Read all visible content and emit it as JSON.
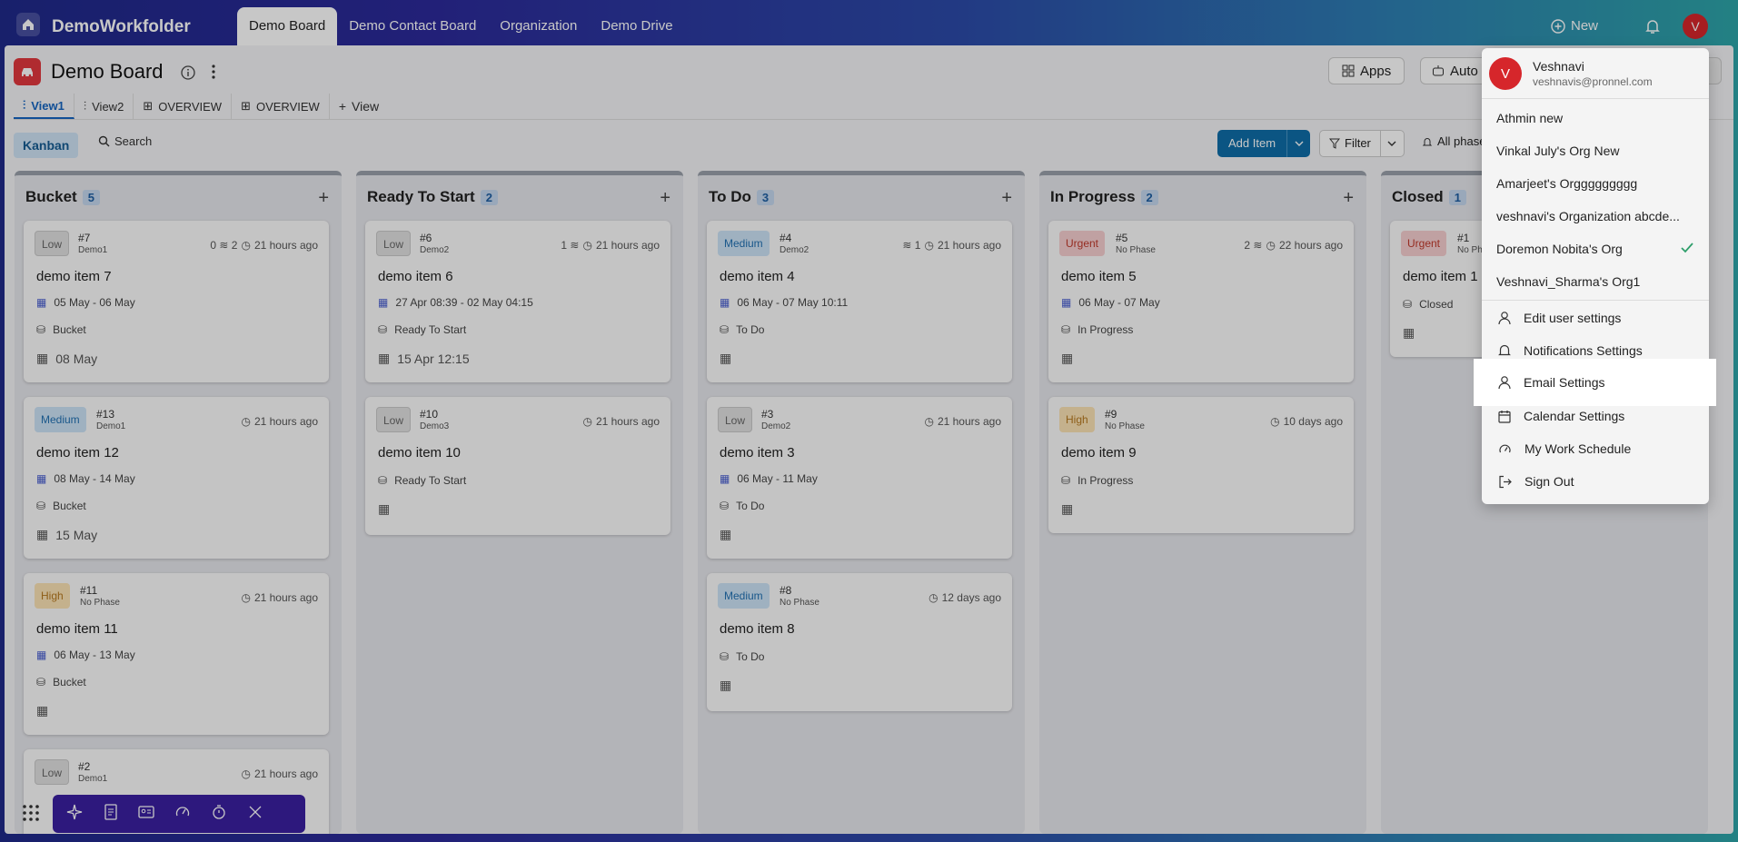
{
  "app": {
    "name": "DemoWorkfolder"
  },
  "top_tabs": [
    "Demo Board",
    "Demo Contact Board",
    "Organization",
    "Demo Drive"
  ],
  "header": {
    "new_label": "New",
    "avatar_letter": "V"
  },
  "board": {
    "title": "Demo Board",
    "apps_label": "Apps",
    "auto_label": "Auto",
    "view_tabs": [
      "View1",
      "View2",
      "OVERVIEW",
      "OVERVIEW"
    ],
    "add_view_label": "View",
    "kanban_label": "Kanban",
    "search_label": "Search",
    "add_item_label": "Add Item",
    "filter_label": "Filter",
    "phases_label": "All phases"
  },
  "columns": [
    {
      "name": "Bucket",
      "count": "5",
      "cards": [
        {
          "priority": "Low",
          "num": "#7",
          "sub": "Demo1",
          "meta": "0 ≋ 2",
          "time": "21 hours ago",
          "title": "demo item 7",
          "dates": "05 May  -  06 May",
          "phase": "Bucket",
          "due": "08 May"
        },
        {
          "priority": "Medium",
          "num": "#13",
          "sub": "Demo1",
          "meta": "",
          "time": "21 hours ago",
          "title": "demo item 12",
          "dates": "08 May  -  14 May",
          "phase": "Bucket",
          "due": "15 May"
        },
        {
          "priority": "High",
          "num": "#11",
          "sub": "No Phase",
          "meta": "",
          "time": "21 hours ago",
          "title": "demo item 11",
          "dates": "06 May  -  13 May",
          "phase": "Bucket",
          "due": ""
        },
        {
          "priority": "Low",
          "num": "#2",
          "sub": "Demo1",
          "meta": "",
          "time": "21 hours ago",
          "title": "",
          "dates": "",
          "phase": "",
          "due": ""
        }
      ]
    },
    {
      "name": "Ready To Start",
      "count": "2",
      "cards": [
        {
          "priority": "Low",
          "num": "#6",
          "sub": "Demo2",
          "meta": "1 ≋",
          "time": "21 hours ago",
          "title": "demo item 6",
          "dates": "27 Apr 08:39  -  02 May 04:15",
          "phase": "Ready To Start",
          "due": "15 Apr 12:15"
        },
        {
          "priority": "Low",
          "num": "#10",
          "sub": "Demo3",
          "meta": "",
          "time": "21 hours ago",
          "title": "demo item 10",
          "dates": "",
          "phase": "Ready To Start",
          "due": ""
        }
      ]
    },
    {
      "name": "To Do",
      "count": "3",
      "cards": [
        {
          "priority": "Medium",
          "num": "#4",
          "sub": "Demo2",
          "meta": "≋ 1",
          "time": "21 hours ago",
          "title": "demo item 4",
          "dates": "06 May  -  07 May 10:11",
          "phase": "To Do",
          "due": ""
        },
        {
          "priority": "Low",
          "num": "#3",
          "sub": "Demo2",
          "meta": "",
          "time": "21 hours ago",
          "title": "demo item 3",
          "dates": "06 May  -  11 May",
          "phase": "To Do",
          "due": ""
        },
        {
          "priority": "Medium",
          "num": "#8",
          "sub": "No Phase",
          "meta": "",
          "time": "12 days ago",
          "title": "demo item 8",
          "dates": "",
          "phase": "To Do",
          "due": ""
        }
      ]
    },
    {
      "name": "In Progress",
      "count": "2",
      "cards": [
        {
          "priority": "Urgent",
          "num": "#5",
          "sub": "No Phase",
          "meta": "2 ≋",
          "time": "22 hours ago",
          "title": "demo item 5",
          "dates": "06 May  -  07 May",
          "phase": "In Progress",
          "due": ""
        },
        {
          "priority": "High",
          "num": "#9",
          "sub": "No Phase",
          "meta": "",
          "time": "10 days ago",
          "title": "demo item 9",
          "dates": "",
          "phase": "In Progress",
          "due": ""
        }
      ]
    },
    {
      "name": "Closed",
      "count": "1",
      "cards": [
        {
          "priority": "Urgent",
          "num": "#1",
          "sub": "No Phase",
          "meta": "",
          "time": "",
          "title": "demo item 1",
          "dates": "",
          "phase": "Closed",
          "due": ""
        }
      ]
    }
  ],
  "menu": {
    "user_name": "Veshnavi",
    "user_email": "veshnavis@pronnel.com",
    "avatar_letter": "V",
    "orgs": [
      "Athmin new",
      "Vinkal July's Org New",
      "Amarjeet's Orggggggggg",
      "veshnavi's Organization abcde...",
      "Doremon Nobita's Org",
      "Veshnavi_Sharma's Org1"
    ],
    "items": [
      "Edit user settings",
      "Notifications Settings",
      "Email Settings",
      "Calendar Settings",
      "My Work Schedule",
      "Sign Out"
    ]
  },
  "colors": {
    "accent": "#0f6ea8",
    "brand_avatar": "#d6262b",
    "check": "#2e9e6a"
  }
}
